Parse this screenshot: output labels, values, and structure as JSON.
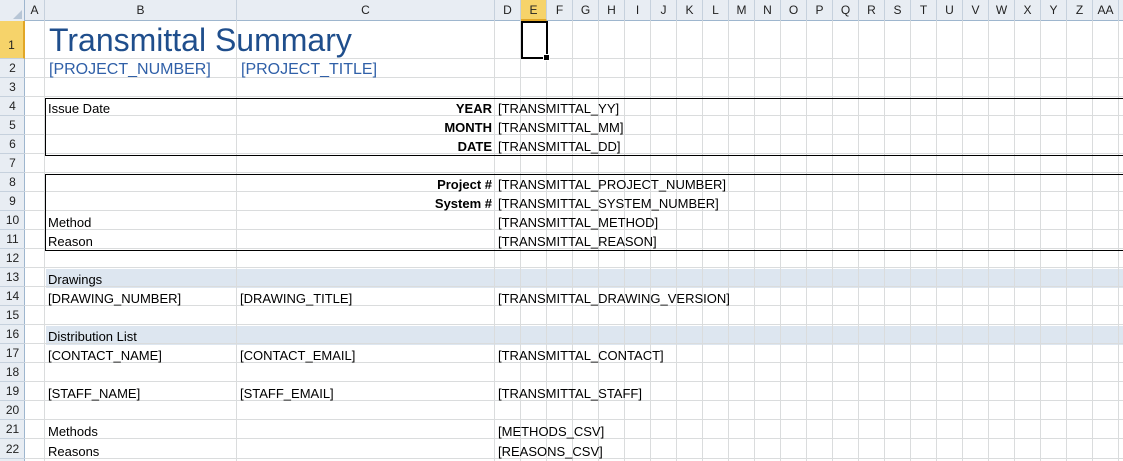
{
  "columns": [
    "A",
    "B",
    "C",
    "D",
    "E",
    "F",
    "G",
    "H",
    "I",
    "J",
    "K",
    "L",
    "M",
    "N",
    "O",
    "P",
    "Q",
    "R",
    "S",
    "T",
    "U",
    "V",
    "W",
    "X",
    "Y",
    "Z",
    "AA"
  ],
  "selected_column": "E",
  "selected_row": "1",
  "rows": [
    "1",
    "2",
    "3",
    "4",
    "5",
    "6",
    "7",
    "8",
    "9",
    "10",
    "11",
    "12",
    "13",
    "14",
    "15",
    "16",
    "17",
    "18",
    "19",
    "20",
    "21",
    "22"
  ],
  "title": "Transmittal Summary",
  "project_number": "[PROJECT_NUMBER]",
  "project_title": "[PROJECT_TITLE]",
  "issue_date": {
    "label": "Issue Date",
    "year_label": "YEAR",
    "year_value": "[TRANSMITTAL_YY]",
    "month_label": "MONTH",
    "month_value": "[TRANSMITTAL_MM]",
    "date_label": "DATE",
    "date_value": "[TRANSMITTAL_DD]"
  },
  "details": {
    "project_label": "Project #",
    "project_value": "[TRANSMITTAL_PROJECT_NUMBER]",
    "system_label": "System #",
    "system_value": "[TRANSMITTAL_SYSTEM_NUMBER]",
    "method_label": "Method",
    "method_value": "[TRANSMITTAL_METHOD]",
    "reason_label": "Reason",
    "reason_value": "[TRANSMITTAL_REASON]"
  },
  "drawings": {
    "heading": "Drawings",
    "number": "[DRAWING_NUMBER]",
    "title": "[DRAWING_TITLE]",
    "version": "[TRANSMITTAL_DRAWING_VERSION]"
  },
  "distribution": {
    "heading": "Distribution List",
    "contact_name": "[CONTACT_NAME]",
    "contact_email": "[CONTACT_EMAIL]",
    "contact_value": "[TRANSMITTAL_CONTACT]",
    "staff_name": "[STAFF_NAME]",
    "staff_email": "[STAFF_EMAIL]",
    "staff_value": "[TRANSMITTAL_STAFF]"
  },
  "footer": {
    "methods_label": "Methods",
    "methods_value": "[METHODS_CSV]",
    "reasons_label": "Reasons",
    "reasons_value": "[REASONS_CSV]"
  },
  "colors": {
    "title": "#1f4e8c",
    "band": "#dde6f0",
    "header_bg": "#e8edf3",
    "selected_header": "#f6d36a",
    "gridline": "#dadcdd"
  }
}
